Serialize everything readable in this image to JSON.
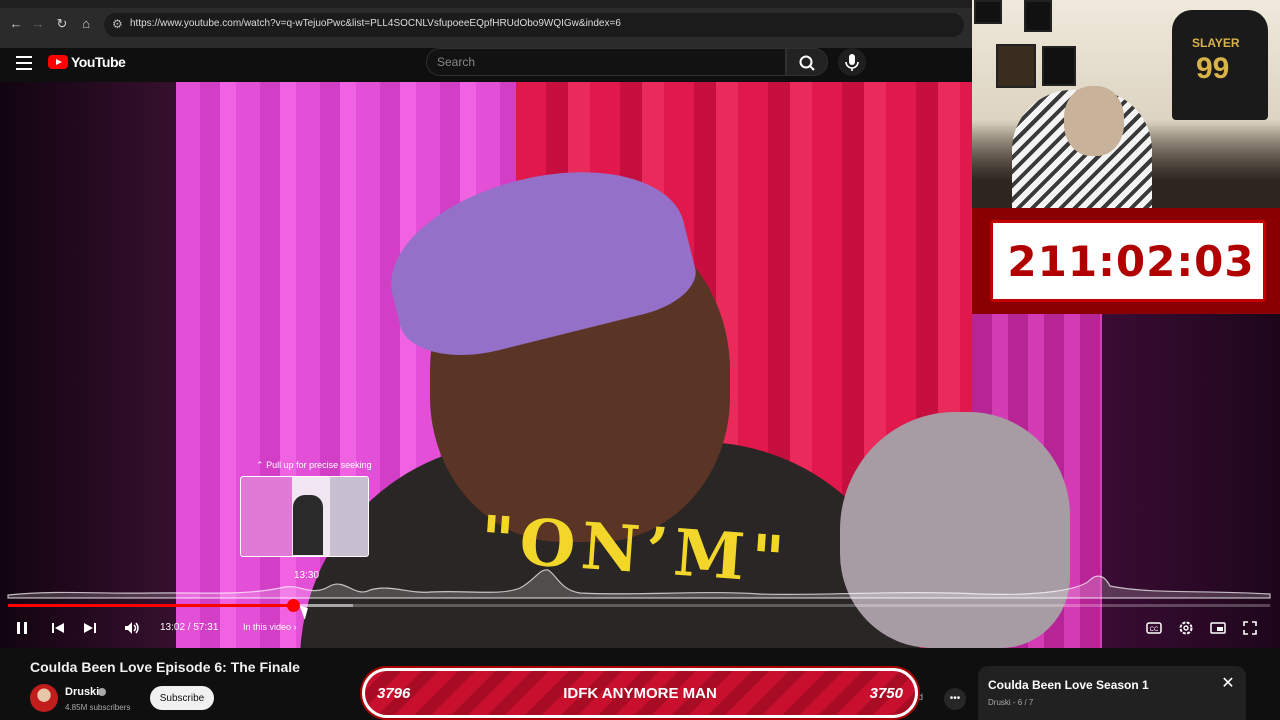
{
  "browser": {
    "url": "https://www.youtube.com/watch?v=q-wTejuoPwc&list=PLL4SOCNLVsfupoeeEQpfHRUdObo9WQIGw&index=6"
  },
  "header": {
    "logo_text": "YouTube",
    "search_placeholder": "Search"
  },
  "player": {
    "seek_hint": "Pull up for precise seeking",
    "seek_preview_time": "13:30",
    "current_time": "13:02",
    "duration": "57:31",
    "time_display": "13:02 / 57:31",
    "chapter_button": "In this video",
    "progress_played_fraction": 0.226,
    "progress_buffered_fraction": 0.273,
    "shirt_text": "\"ON’M\""
  },
  "overlay": {
    "timer": "211:02:03",
    "counter_left": "3796",
    "counter_label": "IDFK ANYMORE MAN",
    "counter_right": "3750",
    "jersey_name": "SLAYER",
    "jersey_number": "99"
  },
  "video_info": {
    "title": "Coulda Been Love Episode 6: The Finale",
    "channel": "Druski",
    "subscribers": "4.85M subscribers",
    "subscribe_label": "Subscribe",
    "ad_fragment": "d"
  },
  "playlist": {
    "title": "Coulda Been Love Season 1",
    "subtitle": "Druski - 6 / 7"
  },
  "colors": {
    "accent": "#ff0000",
    "timer_red": "#b00000",
    "banner_red": "#c8102e"
  },
  "icons": [
    "back-icon",
    "forward-icon",
    "reload-icon",
    "home-icon",
    "menu-icon",
    "search-icon",
    "mic-icon",
    "pause-icon",
    "previous-icon",
    "next-icon",
    "volume-icon",
    "captions-icon",
    "settings-icon",
    "miniplayer-icon",
    "fullscreen-icon",
    "close-icon",
    "more-icon",
    "verified-icon"
  ]
}
